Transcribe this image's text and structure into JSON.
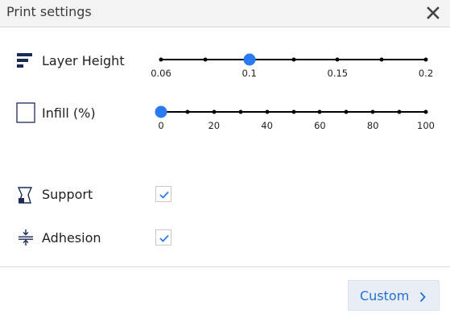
{
  "header": {
    "title": "Print settings",
    "close_icon": "close-icon"
  },
  "layer_height": {
    "label": "Layer Height",
    "icon": "layer-height-icon",
    "ticks": [
      "0.06",
      "",
      "0.1",
      "",
      "0.15",
      "",
      "0.2"
    ],
    "value": "0.1"
  },
  "infill": {
    "label": "Infill (%)",
    "icon": "infill-icon",
    "ticks": [
      "0",
      "",
      "20",
      "",
      "40",
      "",
      "60",
      "",
      "80",
      "",
      "100"
    ],
    "value": "0"
  },
  "support": {
    "label": "Support",
    "icon": "support-icon",
    "checked": true
  },
  "adhesion": {
    "label": "Adhesion",
    "icon": "adhesion-icon",
    "checked": true
  },
  "footer": {
    "custom_label": "Custom",
    "chevron_icon": "chevron-right-icon"
  },
  "colors": {
    "accent": "#2a7bf3",
    "button_text": "#1f6fd6",
    "icon": "#1c2b55"
  }
}
